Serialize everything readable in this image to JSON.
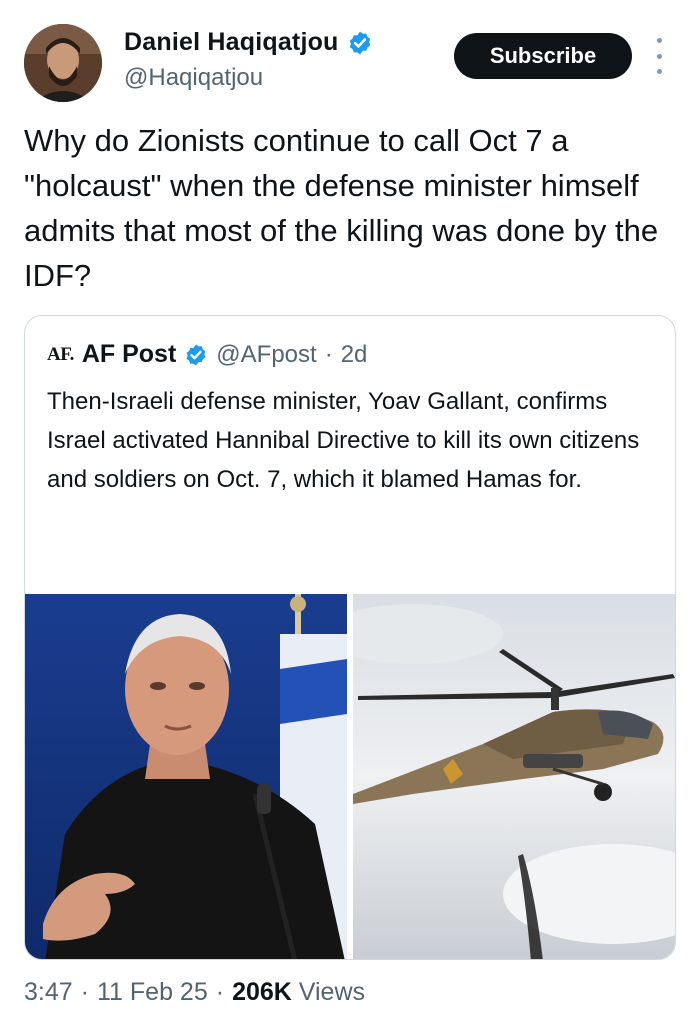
{
  "author": {
    "name": "Daniel Haqiqatjou",
    "handle": "@Haqiqatjou",
    "verified": true
  },
  "subscribe_label": "Subscribe",
  "tweet_text": "Why do Zionists continue to call Oct 7 a \"holcaust\" when the defense minister himself admits that most of the killing was done by the IDF?",
  "quote": {
    "logo": "AF.",
    "name": "AF Post",
    "handle": "@AFpost",
    "separator": "·",
    "age": "2d",
    "text": "Then-Israeli defense minister, Yoav Gallant, confirms Israel activated Hannibal Directive to kill its own citizens and soldiers on Oct. 7, which it blamed Hamas for.",
    "ellipsis": "...",
    "images": [
      "man-in-black-shirt-photo",
      "attack-helicopter-photo"
    ]
  },
  "footer": {
    "time": "3:47",
    "sep1": "·",
    "date": "11 Feb 25",
    "sep2": "·",
    "views_count": "206K",
    "views_label": "Views"
  },
  "colors": {
    "verified_blue": "#1d9bf0",
    "secondary_text": "#536471",
    "primary_text": "#0f1419",
    "border": "#cfd9de"
  }
}
